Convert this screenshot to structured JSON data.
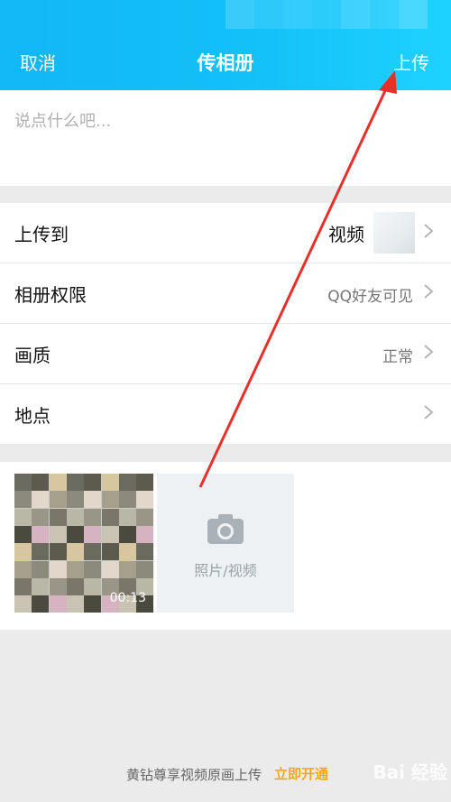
{
  "header": {
    "cancel_label": "取消",
    "title": "传相册",
    "upload_label": "上传"
  },
  "caption": {
    "placeholder": "说点什么吧..."
  },
  "settings": [
    {
      "label": "上传到",
      "value": "视频"
    },
    {
      "label": "相册权限",
      "value": "QQ好友可见"
    },
    {
      "label": "画质",
      "value": "正常"
    },
    {
      "label": "地点",
      "value": ""
    }
  ],
  "media": {
    "video_duration": "00:13",
    "add_label": "照片/视频"
  },
  "footer": {
    "promo_text": "黄钻尊享视频原画上传",
    "promo_link": "立即开通",
    "watermark": "Bai 经验"
  },
  "colors": {
    "header": "#12b7f5",
    "link": "#f4a81d",
    "arrow": "#e8302a"
  },
  "icons": [
    "chevron-right-icon",
    "camera-icon",
    "red-arrow-annotation"
  ]
}
